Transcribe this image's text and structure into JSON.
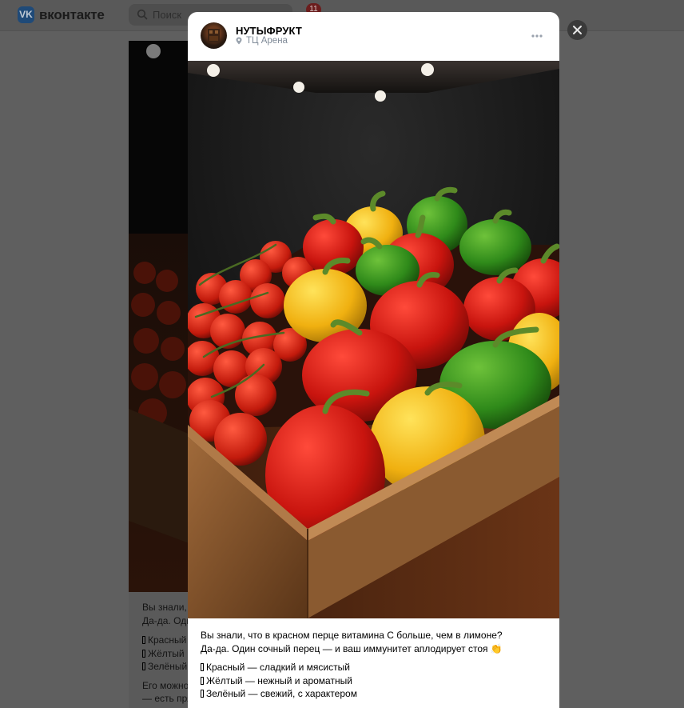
{
  "header": {
    "logo_text": "вконтакте",
    "logo_mark": "VK",
    "search_placeholder": "Поиск",
    "notifications_count": "11"
  },
  "background_post": {
    "lines": [
      "Вы знали,",
      "Да-да. Оди",
      "Красный",
      "Жёлтый",
      "Зелёный",
      "Его можно",
      "— есть пря"
    ]
  },
  "post": {
    "author": "НУТЫФРУКТ",
    "location": "ТЦ Арена",
    "text": {
      "line1": "Вы знали, что в красном перце витамина С больше, чем в лимоне?",
      "line2": "Да-да. Один сочный перец — и ваш иммунитет аплодирует стоя",
      "emoji": "👏",
      "items": [
        "Красный — сладкий и мясистый",
        "Жёлтый — нежный и ароматный",
        "Зелёный — свежий, с характером"
      ]
    }
  },
  "icons": {
    "location": "map-pin-icon",
    "more": "more-dots-icon",
    "close": "close-icon",
    "search": "search-icon"
  },
  "colors": {
    "author_text": "#000000",
    "secondary_text": "#818c99",
    "close_bg": "#3a3a3a"
  }
}
